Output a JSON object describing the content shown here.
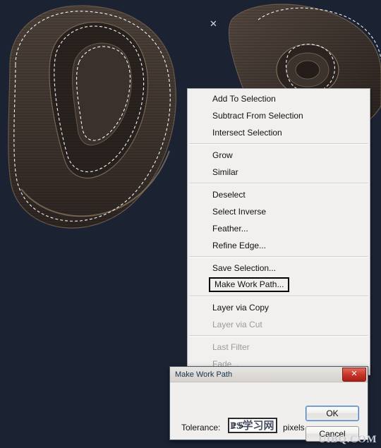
{
  "window": {
    "background_color": "#1b2333",
    "artwork_color": "#413731"
  },
  "context_menu": {
    "groups": [
      [
        {
          "label": "Add To Selection",
          "disabled": false,
          "highlighted": false
        },
        {
          "label": "Subtract From Selection",
          "disabled": false,
          "highlighted": false
        },
        {
          "label": "Intersect Selection",
          "disabled": false,
          "highlighted": false
        }
      ],
      [
        {
          "label": "Grow",
          "disabled": false,
          "highlighted": false
        },
        {
          "label": "Similar",
          "disabled": false,
          "highlighted": false
        }
      ],
      [
        {
          "label": "Deselect",
          "disabled": false,
          "highlighted": false
        },
        {
          "label": "Select Inverse",
          "disabled": false,
          "highlighted": false
        },
        {
          "label": "Feather...",
          "disabled": false,
          "highlighted": false
        },
        {
          "label": "Refine Edge...",
          "disabled": false,
          "highlighted": false
        }
      ],
      [
        {
          "label": "Save Selection...",
          "disabled": false,
          "highlighted": false
        },
        {
          "label": "Make Work Path...",
          "disabled": false,
          "highlighted": true
        }
      ],
      [
        {
          "label": "Layer via Copy",
          "disabled": false,
          "highlighted": false
        },
        {
          "label": "Layer via Cut",
          "disabled": true,
          "highlighted": false
        }
      ],
      [
        {
          "label": "Last Filter",
          "disabled": true,
          "highlighted": false
        },
        {
          "label": "Fade...",
          "disabled": true,
          "highlighted": false
        }
      ]
    ]
  },
  "dialog": {
    "title": "Make Work Path",
    "close_label": "✕",
    "tolerance_label": "Tolerance:",
    "tolerance_value": "1.5",
    "tolerance_units": "pixels",
    "ok_label": "OK",
    "cancel_label": "Cancel"
  },
  "watermarks": {
    "right": "UIBQ.COM",
    "center": "PS学习网"
  },
  "cursor": {
    "glyph": "✕"
  }
}
